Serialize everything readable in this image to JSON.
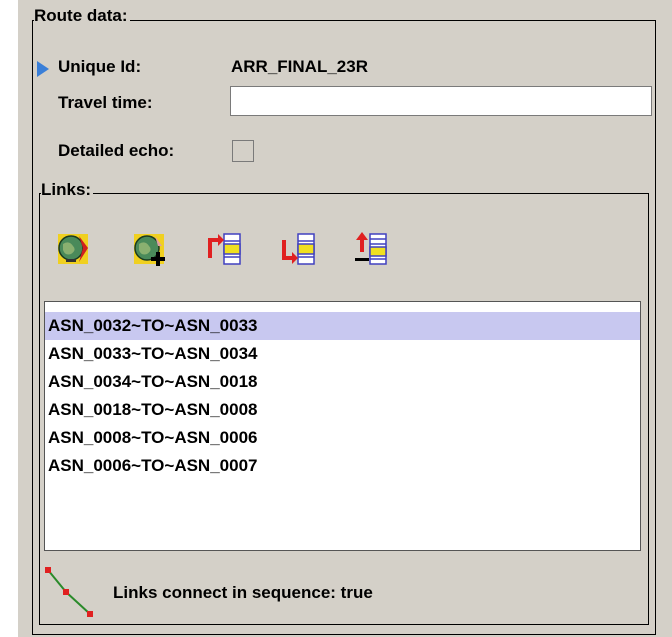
{
  "route": {
    "group_title": "Route data:",
    "unique_id_label": "Unique Id:",
    "unique_id_value": "ARR_FINAL_23R",
    "travel_time_label": "Travel time:",
    "travel_time_value": "",
    "detailed_echo_label": "Detailed echo:",
    "detailed_echo_checked": false
  },
  "links": {
    "group_title": "Links:",
    "toolbar": [
      {
        "icon": "globe-import-icon"
      },
      {
        "icon": "globe-add-icon"
      },
      {
        "icon": "insert-before-icon"
      },
      {
        "icon": "insert-after-icon"
      },
      {
        "icon": "reorder-icon"
      }
    ],
    "items": [
      {
        "label": "ASN_0032~TO~ASN_0033",
        "selected": true
      },
      {
        "label": "ASN_0033~TO~ASN_0034",
        "selected": false
      },
      {
        "label": "ASN_0034~TO~ASN_0018",
        "selected": false
      },
      {
        "label": "ASN_0018~TO~ASN_0008",
        "selected": false
      },
      {
        "label": "ASN_0008~TO~ASN_0006",
        "selected": false
      },
      {
        "label": "ASN_0006~TO~ASN_0007",
        "selected": false
      }
    ],
    "status_text": "Links connect in sequence: true"
  },
  "colors": {
    "panel_bg": "#d4d0c8",
    "selection": "#c8c8f0",
    "marker": "#3a7fd8"
  }
}
